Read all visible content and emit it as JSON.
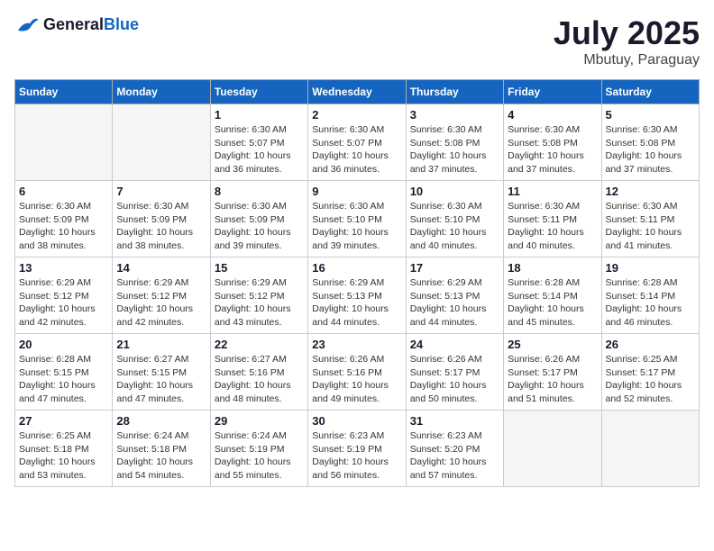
{
  "header": {
    "logo_general": "General",
    "logo_blue": "Blue",
    "month": "July 2025",
    "location": "Mbutuy, Paraguay"
  },
  "weekdays": [
    "Sunday",
    "Monday",
    "Tuesday",
    "Wednesday",
    "Thursday",
    "Friday",
    "Saturday"
  ],
  "weeks": [
    [
      {
        "day": "",
        "empty": true
      },
      {
        "day": "",
        "empty": true
      },
      {
        "day": "1",
        "sunrise": "Sunrise: 6:30 AM",
        "sunset": "Sunset: 5:07 PM",
        "daylight": "Daylight: 10 hours and 36 minutes."
      },
      {
        "day": "2",
        "sunrise": "Sunrise: 6:30 AM",
        "sunset": "Sunset: 5:07 PM",
        "daylight": "Daylight: 10 hours and 36 minutes."
      },
      {
        "day": "3",
        "sunrise": "Sunrise: 6:30 AM",
        "sunset": "Sunset: 5:08 PM",
        "daylight": "Daylight: 10 hours and 37 minutes."
      },
      {
        "day": "4",
        "sunrise": "Sunrise: 6:30 AM",
        "sunset": "Sunset: 5:08 PM",
        "daylight": "Daylight: 10 hours and 37 minutes."
      },
      {
        "day": "5",
        "sunrise": "Sunrise: 6:30 AM",
        "sunset": "Sunset: 5:08 PM",
        "daylight": "Daylight: 10 hours and 37 minutes."
      }
    ],
    [
      {
        "day": "6",
        "sunrise": "Sunrise: 6:30 AM",
        "sunset": "Sunset: 5:09 PM",
        "daylight": "Daylight: 10 hours and 38 minutes."
      },
      {
        "day": "7",
        "sunrise": "Sunrise: 6:30 AM",
        "sunset": "Sunset: 5:09 PM",
        "daylight": "Daylight: 10 hours and 38 minutes."
      },
      {
        "day": "8",
        "sunrise": "Sunrise: 6:30 AM",
        "sunset": "Sunset: 5:09 PM",
        "daylight": "Daylight: 10 hours and 39 minutes."
      },
      {
        "day": "9",
        "sunrise": "Sunrise: 6:30 AM",
        "sunset": "Sunset: 5:10 PM",
        "daylight": "Daylight: 10 hours and 39 minutes."
      },
      {
        "day": "10",
        "sunrise": "Sunrise: 6:30 AM",
        "sunset": "Sunset: 5:10 PM",
        "daylight": "Daylight: 10 hours and 40 minutes."
      },
      {
        "day": "11",
        "sunrise": "Sunrise: 6:30 AM",
        "sunset": "Sunset: 5:11 PM",
        "daylight": "Daylight: 10 hours and 40 minutes."
      },
      {
        "day": "12",
        "sunrise": "Sunrise: 6:30 AM",
        "sunset": "Sunset: 5:11 PM",
        "daylight": "Daylight: 10 hours and 41 minutes."
      }
    ],
    [
      {
        "day": "13",
        "sunrise": "Sunrise: 6:29 AM",
        "sunset": "Sunset: 5:12 PM",
        "daylight": "Daylight: 10 hours and 42 minutes."
      },
      {
        "day": "14",
        "sunrise": "Sunrise: 6:29 AM",
        "sunset": "Sunset: 5:12 PM",
        "daylight": "Daylight: 10 hours and 42 minutes."
      },
      {
        "day": "15",
        "sunrise": "Sunrise: 6:29 AM",
        "sunset": "Sunset: 5:12 PM",
        "daylight": "Daylight: 10 hours and 43 minutes."
      },
      {
        "day": "16",
        "sunrise": "Sunrise: 6:29 AM",
        "sunset": "Sunset: 5:13 PM",
        "daylight": "Daylight: 10 hours and 44 minutes."
      },
      {
        "day": "17",
        "sunrise": "Sunrise: 6:29 AM",
        "sunset": "Sunset: 5:13 PM",
        "daylight": "Daylight: 10 hours and 44 minutes."
      },
      {
        "day": "18",
        "sunrise": "Sunrise: 6:28 AM",
        "sunset": "Sunset: 5:14 PM",
        "daylight": "Daylight: 10 hours and 45 minutes."
      },
      {
        "day": "19",
        "sunrise": "Sunrise: 6:28 AM",
        "sunset": "Sunset: 5:14 PM",
        "daylight": "Daylight: 10 hours and 46 minutes."
      }
    ],
    [
      {
        "day": "20",
        "sunrise": "Sunrise: 6:28 AM",
        "sunset": "Sunset: 5:15 PM",
        "daylight": "Daylight: 10 hours and 47 minutes."
      },
      {
        "day": "21",
        "sunrise": "Sunrise: 6:27 AM",
        "sunset": "Sunset: 5:15 PM",
        "daylight": "Daylight: 10 hours and 47 minutes."
      },
      {
        "day": "22",
        "sunrise": "Sunrise: 6:27 AM",
        "sunset": "Sunset: 5:16 PM",
        "daylight": "Daylight: 10 hours and 48 minutes."
      },
      {
        "day": "23",
        "sunrise": "Sunrise: 6:26 AM",
        "sunset": "Sunset: 5:16 PM",
        "daylight": "Daylight: 10 hours and 49 minutes."
      },
      {
        "day": "24",
        "sunrise": "Sunrise: 6:26 AM",
        "sunset": "Sunset: 5:17 PM",
        "daylight": "Daylight: 10 hours and 50 minutes."
      },
      {
        "day": "25",
        "sunrise": "Sunrise: 6:26 AM",
        "sunset": "Sunset: 5:17 PM",
        "daylight": "Daylight: 10 hours and 51 minutes."
      },
      {
        "day": "26",
        "sunrise": "Sunrise: 6:25 AM",
        "sunset": "Sunset: 5:17 PM",
        "daylight": "Daylight: 10 hours and 52 minutes."
      }
    ],
    [
      {
        "day": "27",
        "sunrise": "Sunrise: 6:25 AM",
        "sunset": "Sunset: 5:18 PM",
        "daylight": "Daylight: 10 hours and 53 minutes."
      },
      {
        "day": "28",
        "sunrise": "Sunrise: 6:24 AM",
        "sunset": "Sunset: 5:18 PM",
        "daylight": "Daylight: 10 hours and 54 minutes."
      },
      {
        "day": "29",
        "sunrise": "Sunrise: 6:24 AM",
        "sunset": "Sunset: 5:19 PM",
        "daylight": "Daylight: 10 hours and 55 minutes."
      },
      {
        "day": "30",
        "sunrise": "Sunrise: 6:23 AM",
        "sunset": "Sunset: 5:19 PM",
        "daylight": "Daylight: 10 hours and 56 minutes."
      },
      {
        "day": "31",
        "sunrise": "Sunrise: 6:23 AM",
        "sunset": "Sunset: 5:20 PM",
        "daylight": "Daylight: 10 hours and 57 minutes."
      },
      {
        "day": "",
        "empty": true
      },
      {
        "day": "",
        "empty": true
      }
    ]
  ]
}
